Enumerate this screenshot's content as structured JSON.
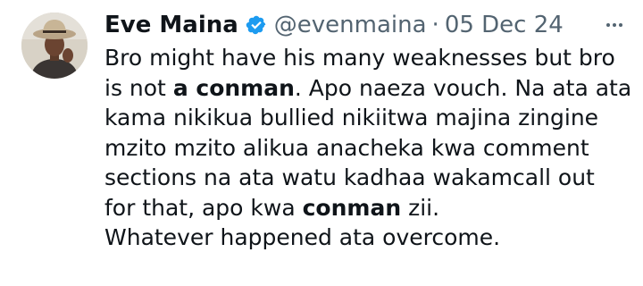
{
  "tweet": {
    "author": {
      "name": "Eve Maina",
      "handle": "@evenmaina",
      "verified": true,
      "avatar_icon": "profile-photo"
    },
    "separator": "·",
    "date": "05 Dec 24",
    "more_icon": "more-horizontal-icon",
    "body": {
      "l1": "Bro might have his many weaknesses but bro",
      "l2a": "is not ",
      "l2b": "a conman",
      "l2c": ". Apo naeza vouch. Na ata ata",
      "l3": "kama nikikua bullied nikiitwa majina zingine",
      "l4": "mzito mzito alikua anacheka kwa comment",
      "l5": "sections na ata watu kadhaa wakamcall out",
      "l6a": "for that, apo kwa ",
      "l6b": "conman",
      "l6c": " zii.",
      "l7": "Whatever happened ata overcome."
    }
  },
  "colors": {
    "text": "#0f1419",
    "secondary": "#536471",
    "verified_blue": "#1d9bf0"
  }
}
